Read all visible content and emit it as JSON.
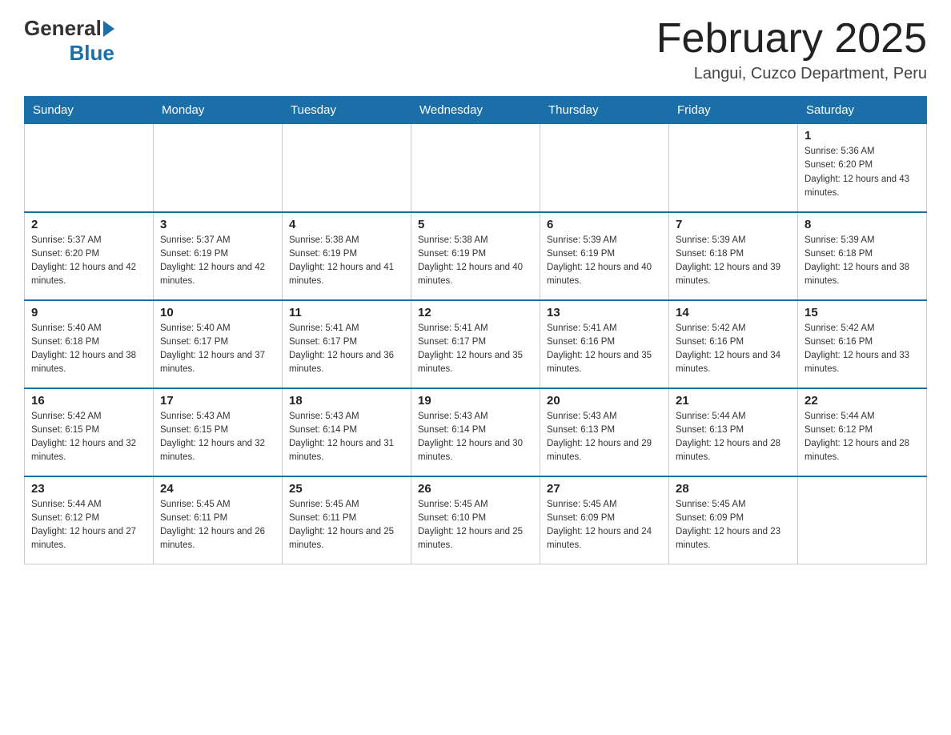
{
  "header": {
    "logo_general": "General",
    "logo_blue": "Blue",
    "title": "February 2025",
    "subtitle": "Langui, Cuzco Department, Peru"
  },
  "weekdays": [
    "Sunday",
    "Monday",
    "Tuesday",
    "Wednesday",
    "Thursday",
    "Friday",
    "Saturday"
  ],
  "weeks": [
    [
      {
        "day": "",
        "sunrise": "",
        "sunset": "",
        "daylight": ""
      },
      {
        "day": "",
        "sunrise": "",
        "sunset": "",
        "daylight": ""
      },
      {
        "day": "",
        "sunrise": "",
        "sunset": "",
        "daylight": ""
      },
      {
        "day": "",
        "sunrise": "",
        "sunset": "",
        "daylight": ""
      },
      {
        "day": "",
        "sunrise": "",
        "sunset": "",
        "daylight": ""
      },
      {
        "day": "",
        "sunrise": "",
        "sunset": "",
        "daylight": ""
      },
      {
        "day": "1",
        "sunrise": "Sunrise: 5:36 AM",
        "sunset": "Sunset: 6:20 PM",
        "daylight": "Daylight: 12 hours and 43 minutes."
      }
    ],
    [
      {
        "day": "2",
        "sunrise": "Sunrise: 5:37 AM",
        "sunset": "Sunset: 6:20 PM",
        "daylight": "Daylight: 12 hours and 42 minutes."
      },
      {
        "day": "3",
        "sunrise": "Sunrise: 5:37 AM",
        "sunset": "Sunset: 6:19 PM",
        "daylight": "Daylight: 12 hours and 42 minutes."
      },
      {
        "day": "4",
        "sunrise": "Sunrise: 5:38 AM",
        "sunset": "Sunset: 6:19 PM",
        "daylight": "Daylight: 12 hours and 41 minutes."
      },
      {
        "day": "5",
        "sunrise": "Sunrise: 5:38 AM",
        "sunset": "Sunset: 6:19 PM",
        "daylight": "Daylight: 12 hours and 40 minutes."
      },
      {
        "day": "6",
        "sunrise": "Sunrise: 5:39 AM",
        "sunset": "Sunset: 6:19 PM",
        "daylight": "Daylight: 12 hours and 40 minutes."
      },
      {
        "day": "7",
        "sunrise": "Sunrise: 5:39 AM",
        "sunset": "Sunset: 6:18 PM",
        "daylight": "Daylight: 12 hours and 39 minutes."
      },
      {
        "day": "8",
        "sunrise": "Sunrise: 5:39 AM",
        "sunset": "Sunset: 6:18 PM",
        "daylight": "Daylight: 12 hours and 38 minutes."
      }
    ],
    [
      {
        "day": "9",
        "sunrise": "Sunrise: 5:40 AM",
        "sunset": "Sunset: 6:18 PM",
        "daylight": "Daylight: 12 hours and 38 minutes."
      },
      {
        "day": "10",
        "sunrise": "Sunrise: 5:40 AM",
        "sunset": "Sunset: 6:17 PM",
        "daylight": "Daylight: 12 hours and 37 minutes."
      },
      {
        "day": "11",
        "sunrise": "Sunrise: 5:41 AM",
        "sunset": "Sunset: 6:17 PM",
        "daylight": "Daylight: 12 hours and 36 minutes."
      },
      {
        "day": "12",
        "sunrise": "Sunrise: 5:41 AM",
        "sunset": "Sunset: 6:17 PM",
        "daylight": "Daylight: 12 hours and 35 minutes."
      },
      {
        "day": "13",
        "sunrise": "Sunrise: 5:41 AM",
        "sunset": "Sunset: 6:16 PM",
        "daylight": "Daylight: 12 hours and 35 minutes."
      },
      {
        "day": "14",
        "sunrise": "Sunrise: 5:42 AM",
        "sunset": "Sunset: 6:16 PM",
        "daylight": "Daylight: 12 hours and 34 minutes."
      },
      {
        "day": "15",
        "sunrise": "Sunrise: 5:42 AM",
        "sunset": "Sunset: 6:16 PM",
        "daylight": "Daylight: 12 hours and 33 minutes."
      }
    ],
    [
      {
        "day": "16",
        "sunrise": "Sunrise: 5:42 AM",
        "sunset": "Sunset: 6:15 PM",
        "daylight": "Daylight: 12 hours and 32 minutes."
      },
      {
        "day": "17",
        "sunrise": "Sunrise: 5:43 AM",
        "sunset": "Sunset: 6:15 PM",
        "daylight": "Daylight: 12 hours and 32 minutes."
      },
      {
        "day": "18",
        "sunrise": "Sunrise: 5:43 AM",
        "sunset": "Sunset: 6:14 PM",
        "daylight": "Daylight: 12 hours and 31 minutes."
      },
      {
        "day": "19",
        "sunrise": "Sunrise: 5:43 AM",
        "sunset": "Sunset: 6:14 PM",
        "daylight": "Daylight: 12 hours and 30 minutes."
      },
      {
        "day": "20",
        "sunrise": "Sunrise: 5:43 AM",
        "sunset": "Sunset: 6:13 PM",
        "daylight": "Daylight: 12 hours and 29 minutes."
      },
      {
        "day": "21",
        "sunrise": "Sunrise: 5:44 AM",
        "sunset": "Sunset: 6:13 PM",
        "daylight": "Daylight: 12 hours and 28 minutes."
      },
      {
        "day": "22",
        "sunrise": "Sunrise: 5:44 AM",
        "sunset": "Sunset: 6:12 PM",
        "daylight": "Daylight: 12 hours and 28 minutes."
      }
    ],
    [
      {
        "day": "23",
        "sunrise": "Sunrise: 5:44 AM",
        "sunset": "Sunset: 6:12 PM",
        "daylight": "Daylight: 12 hours and 27 minutes."
      },
      {
        "day": "24",
        "sunrise": "Sunrise: 5:45 AM",
        "sunset": "Sunset: 6:11 PM",
        "daylight": "Daylight: 12 hours and 26 minutes."
      },
      {
        "day": "25",
        "sunrise": "Sunrise: 5:45 AM",
        "sunset": "Sunset: 6:11 PM",
        "daylight": "Daylight: 12 hours and 25 minutes."
      },
      {
        "day": "26",
        "sunrise": "Sunrise: 5:45 AM",
        "sunset": "Sunset: 6:10 PM",
        "daylight": "Daylight: 12 hours and 25 minutes."
      },
      {
        "day": "27",
        "sunrise": "Sunrise: 5:45 AM",
        "sunset": "Sunset: 6:09 PM",
        "daylight": "Daylight: 12 hours and 24 minutes."
      },
      {
        "day": "28",
        "sunrise": "Sunrise: 5:45 AM",
        "sunset": "Sunset: 6:09 PM",
        "daylight": "Daylight: 12 hours and 23 minutes."
      },
      {
        "day": "",
        "sunrise": "",
        "sunset": "",
        "daylight": ""
      }
    ]
  ]
}
